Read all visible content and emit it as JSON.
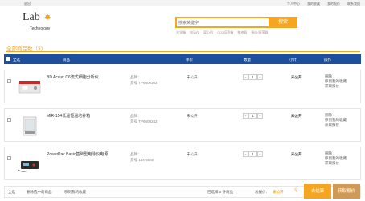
{
  "topbar": {
    "logout": "退出",
    "links": [
      "个人中心",
      "我的收藏",
      "我的报价",
      "联系我们"
    ]
  },
  "logo": {
    "word": "Lab",
    "sub": "Technology"
  },
  "search": {
    "placeholder": "搜索关键字",
    "button": "搜索"
  },
  "hot_keywords": [
    "光学箱",
    "电泳仪",
    "离心机",
    "CO2培养箱",
    "移液器",
    "摇床/振荡器"
  ],
  "cart": {
    "title": "全部商品数（3）",
    "headers": {
      "select_all": "全选",
      "product": "商品",
      "price": "单价",
      "qty": "数量",
      "subtotal": "小计",
      "ops": "操作"
    },
    "items": [
      {
        "name": "BD Accuri C6流式细胞分析仪",
        "brand_label": "品牌：",
        "model": "货号 TP9000302",
        "price": "未公开",
        "qty": "1",
        "subtotal": "未公开",
        "op_delete": "删除",
        "op_fav": "移到我的收藏",
        "op_quote": "获取报价",
        "img": "flow-cytometer"
      },
      {
        "name": "MIR-154低温恒温培养箱",
        "brand_label": "品牌：",
        "model": "货号 TP9000242",
        "price": "未公开",
        "qty": "1",
        "subtotal": "未公开",
        "op_delete": "删除",
        "op_fav": "移到我的收藏",
        "op_quote": "获取报价",
        "img": "incubator"
      },
      {
        "name": "PowerPac Basic基础型电泳仪电源",
        "brand_label": "品牌：",
        "model": "货号 164-5050",
        "price": "未公开",
        "qty": "1",
        "subtotal": "未公开",
        "op_delete": "删除",
        "op_fav": "移到我的收藏",
        "op_quote": "获取报价",
        "img": "power-supply"
      }
    ]
  },
  "footer": {
    "select_all": "全选",
    "delete_selected": "删除选中的商品",
    "move_fav": "移到我的收藏",
    "selected": "已选择 0 件商品",
    "total_label": "总报价：",
    "total_value": "未公开",
    "go_button": "去结算",
    "quote_button": "获取报价"
  },
  "colors": {
    "accent": "#f6a521",
    "header": "#1d4f9c"
  }
}
